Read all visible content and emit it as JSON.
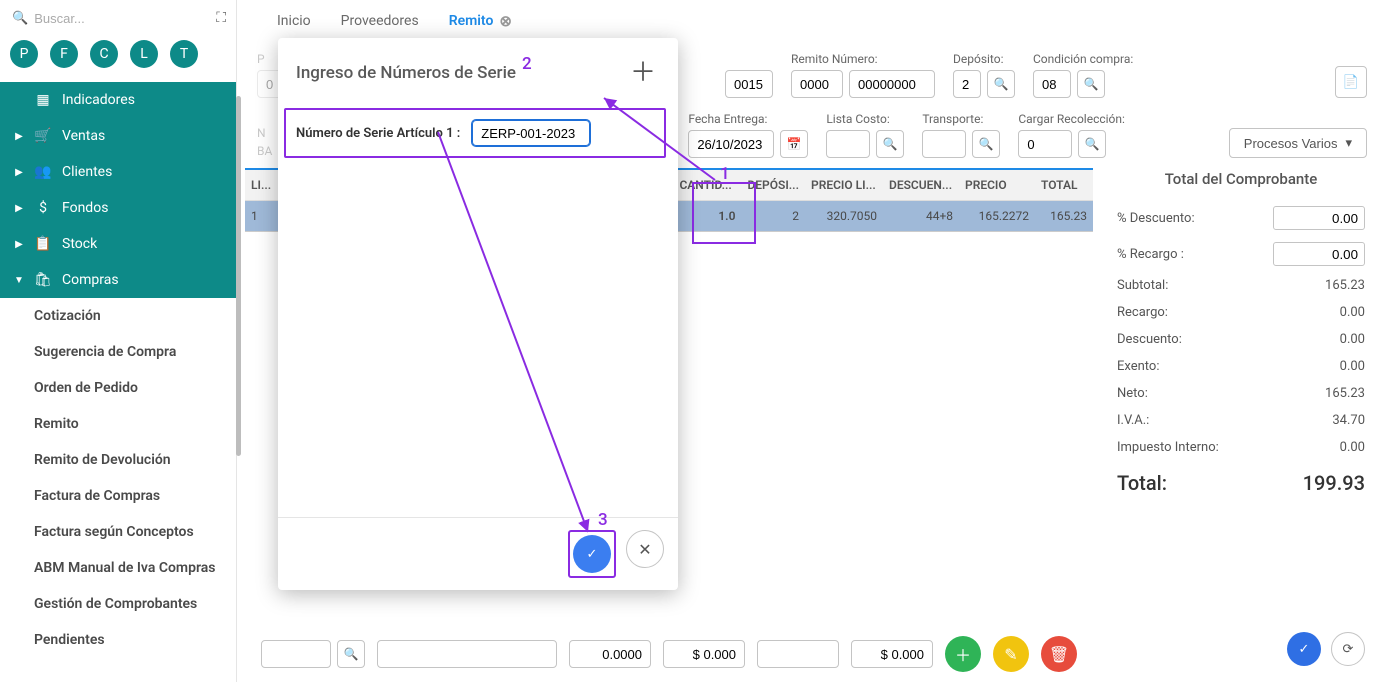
{
  "search": {
    "placeholder": "Buscar..."
  },
  "avatars": [
    "P",
    "F",
    "C",
    "L",
    "T"
  ],
  "nav": {
    "indicadores": "Indicadores",
    "ventas": "Ventas",
    "clientes": "Clientes",
    "fondos": "Fondos",
    "stock": "Stock",
    "compras": "Compras"
  },
  "compras_sub": {
    "cotizacion": "Cotización",
    "sugerencia": "Sugerencia de Compra",
    "orden": "Orden de Pedido",
    "remito": "Remito",
    "remito_dev": "Remito de Devolución",
    "factura_compras": "Factura de Compras",
    "factura_conceptos": "Factura según Conceptos",
    "abm_iva": "ABM Manual de Iva Compras",
    "gestion": "Gestión de Comprobantes",
    "pendientes": "Pendientes"
  },
  "tabs": {
    "inicio": "Inicio",
    "proveedores": "Proveedores",
    "remito": "Remito"
  },
  "form": {
    "seq_hidden": "0015",
    "remito_numero_label": "Remito Número:",
    "remito_numero_a": "0000",
    "remito_numero_b": "00000000",
    "deposito_label": "Depósito:",
    "deposito": "2",
    "condicion_label": "Condición compra:",
    "condicion": "08",
    "fecha_entrega_label": "Fecha Entrega:",
    "fecha_entrega": "26/10/2023",
    "lista_costo_label": "Lista Costo:",
    "transporte_label": "Transporte:",
    "recoleccion_label": "Cargar Recolección:",
    "recoleccion": "0",
    "procesos_label": "Procesos Varios",
    "hidden_pref": "P",
    "hidden_n": "N",
    "hidden_ba": "BA"
  },
  "grid": {
    "headers": {
      "li": "LI...",
      "cantidad": "CANTID...",
      "deposito": "DEPÓSI...",
      "precio_lista": "PRECIO LI...",
      "descuento": "DESCUEN...",
      "precio": "PRECIO",
      "total": "TOTAL"
    },
    "row": {
      "li": "1",
      "cantidad": "1.0",
      "deposito": "2",
      "precio_lista": "320.7050",
      "descuento": "44+8",
      "precio": "165.2272",
      "total": "165.23"
    }
  },
  "totals": {
    "title": "Total del Comprobante",
    "pct_descuento_label": "% Descuento:",
    "pct_descuento": "0.00",
    "pct_recargo_label": "% Recargo :",
    "pct_recargo": "0.00",
    "subtotal_label": "Subtotal:",
    "subtotal": "165.23",
    "recargo_label": "Recargo:",
    "recargo": "0.00",
    "descuento_label": "Descuento:",
    "descuento": "0.00",
    "exento_label": "Exento:",
    "exento": "0.00",
    "neto_label": "Neto:",
    "neto": "165.23",
    "iva_label": "I.V.A.:",
    "iva": "34.70",
    "impuesto_label": "Impuesto Interno:",
    "impuesto": "0.00",
    "total_label": "Total:",
    "total": "199.93"
  },
  "bottom": {
    "val1": "0.0000",
    "val2": "$ 0.000",
    "val3": "$ 0.000"
  },
  "modal": {
    "title": "Ingreso de Números de Serie",
    "serial_label": "Número de Serie Artículo 1 :",
    "serial_value": "ZERP-001-2023"
  },
  "annotations": {
    "a1": "1",
    "a2": "2",
    "a3": "3"
  }
}
